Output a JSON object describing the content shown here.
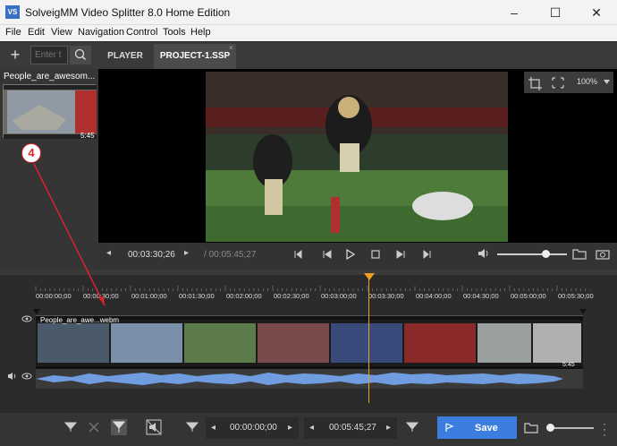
{
  "window": {
    "title": "SolveigMM Video Splitter 8.0 Home Edition",
    "icon_text": "VS",
    "minimize": "–",
    "maximize": "☐",
    "close": "✕"
  },
  "menu": [
    "File",
    "Edit",
    "View",
    "Navigation",
    "Control",
    "Tools",
    "Help"
  ],
  "toolbar": {
    "add": "+",
    "search_placeholder": "Enter t",
    "tabs": [
      {
        "label": "PLAYER"
      },
      {
        "label": "PROJECT-1.SSP"
      }
    ],
    "tab_close": "×"
  },
  "media": {
    "label": "People_are_awesom...",
    "duration": "5:45"
  },
  "viewer": {
    "zoom": "100%"
  },
  "player": {
    "current": "00:03:30;26",
    "total": "/ 00:05:45;27"
  },
  "ruler": {
    "labels": [
      "00:00:00;00",
      "00:00:30;00",
      "00:01:00;00",
      "00:01:30;00",
      "00:02:00;00",
      "00:02:30;00",
      "00:03:00;00",
      "00:03:30;00",
      "00:04:00;00",
      "00:04:30;00",
      "00:05:00;00",
      "00:05:30;00"
    ]
  },
  "track": {
    "label": "People_are_awe...webm",
    "duration": "5:45"
  },
  "bottom": {
    "start": "00:00:00;00",
    "end": "00:05:45;27",
    "save": "Save"
  },
  "annotation": {
    "number": "4"
  },
  "colors": {
    "accent": "#3c7de0",
    "playhead": "#f0a020",
    "waveform": "#6f9de0",
    "callout": "#e0242a"
  }
}
